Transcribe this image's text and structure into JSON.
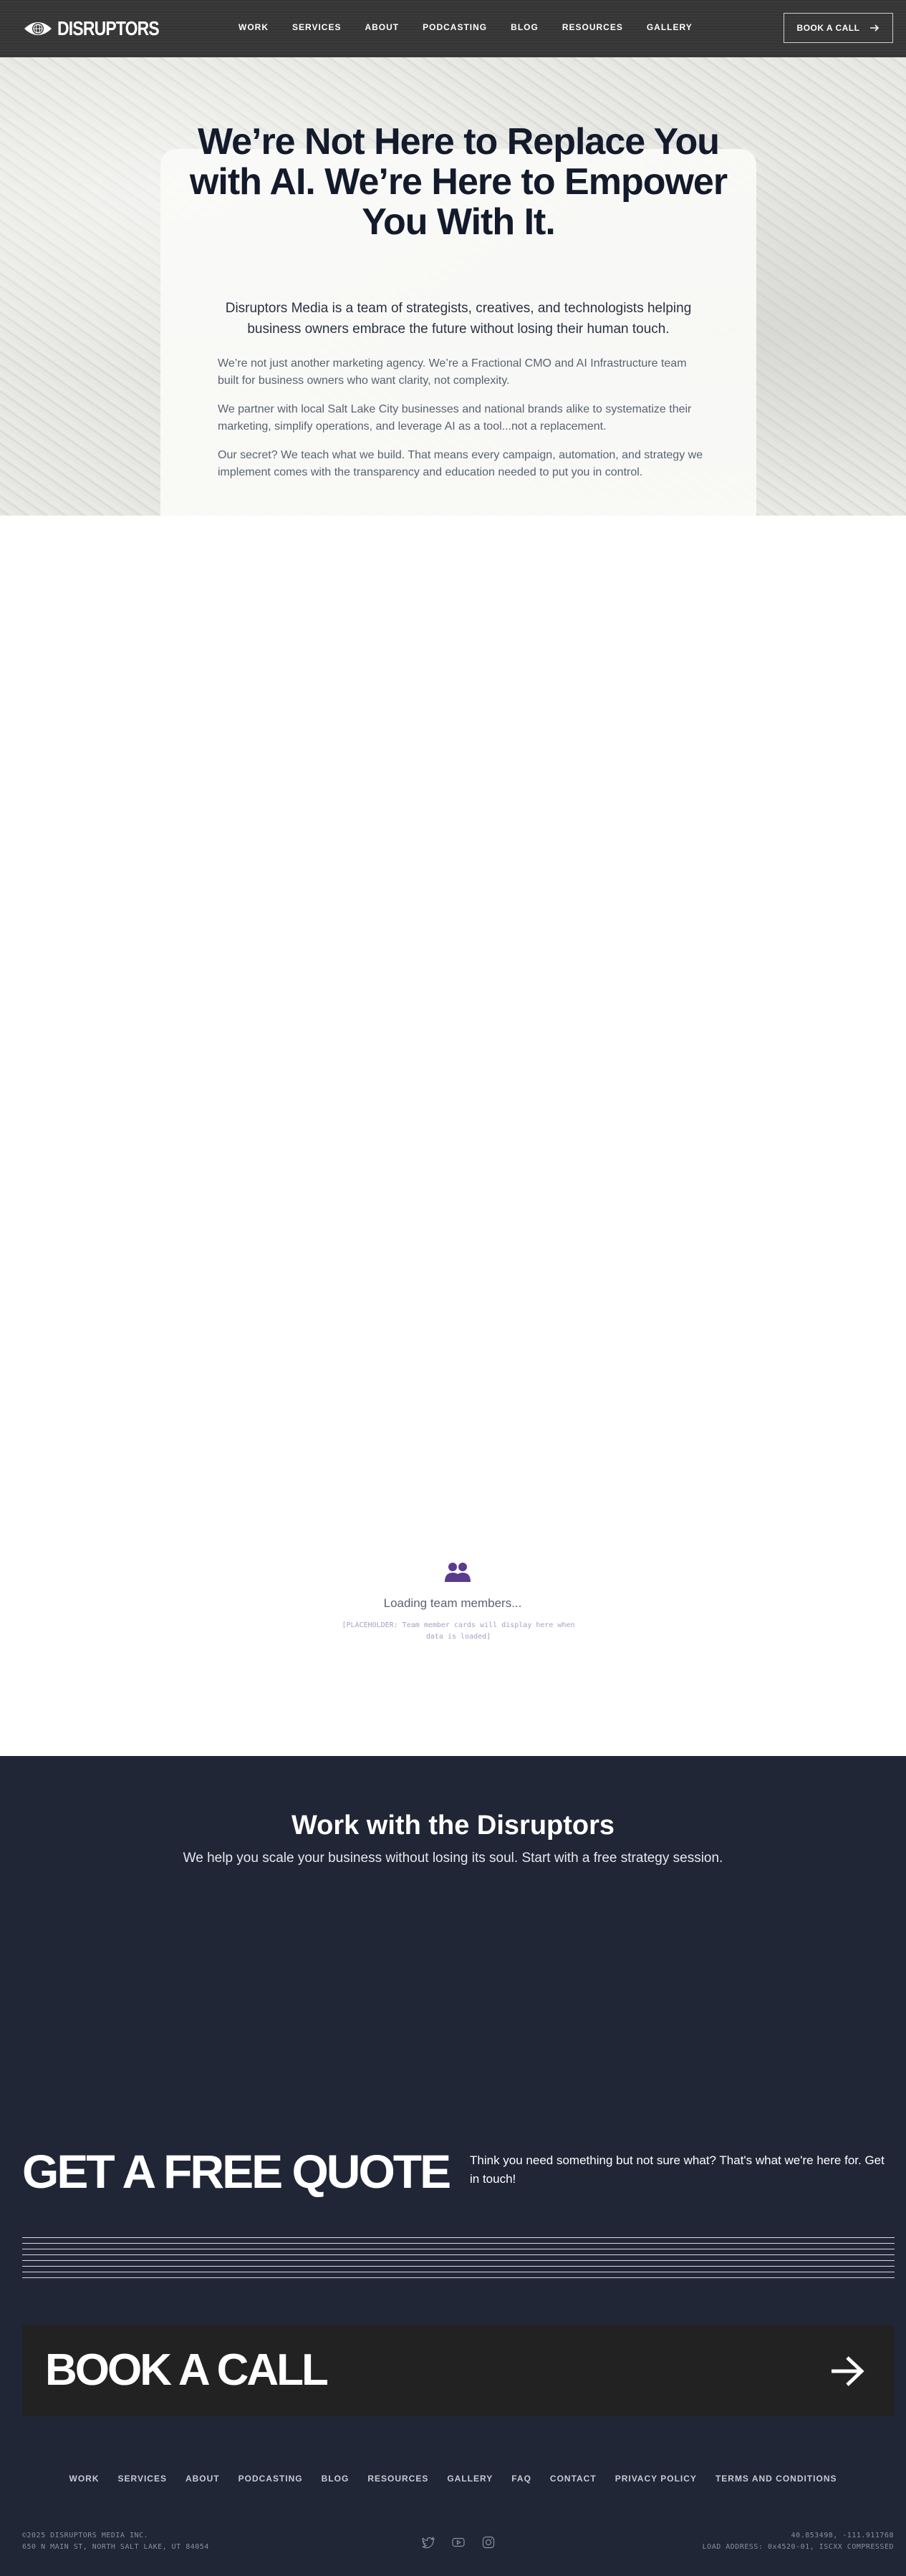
{
  "header": {
    "logo_text": "DISRUPTORS",
    "nav": [
      "WORK",
      "SERVICES",
      "ABOUT",
      "PODCASTING",
      "BLOG",
      "RESOURCES",
      "GALLERY"
    ],
    "book_label": "BOOK A CALL"
  },
  "hero": {
    "title": "We’re Not Here to Replace You with AI. We’re Here to Empower You With It.",
    "subtitle": "Disruptors Media is a team of strategists, creatives, and technologists helping business owners embrace the future without losing their human touch.",
    "p1": "We’re not just another marketing agency. We’re a Fractional CMO and AI Infrastructure team built for business owners who want clarity, not complexity.",
    "p2": "We partner with local Salt Lake City businesses and national brands alike to systematize their marketing, simplify operations, and leverage AI as a tool...not a replacement.",
    "p3": "Our secret? We teach what we build. That means every campaign, automation, and strategy we implement comes with the transparency and education needed to put you in control."
  },
  "team": {
    "loading": "Loading team members...",
    "placeholder": "[PLACEHOLDER: Team member cards will display here when data is loaded]"
  },
  "work": {
    "title": "Work with the Disruptors",
    "subtitle": "We help you scale your business without losing its soul. Start with a free strategy session."
  },
  "footer": {
    "quote_title": "GET A FREE QUOTE",
    "quote_text": "Think you need something but not sure what? That's what we're here for. Get in touch!",
    "call_text": "BOOK A CALL",
    "nav": [
      "WORK",
      "SERVICES",
      "ABOUT",
      "PODCASTING",
      "BLOG",
      "RESOURCES",
      "GALLERY",
      "FAQ",
      "CONTACT",
      "PRIVACY POLICY",
      "TERMS AND CONDITIONS"
    ],
    "copyright": "©2025 DISRUPTORS MEDIA INC.",
    "address": "650 N MAIN ST, NORTH SALT LAKE, UT 84054",
    "coordinates": "40.853498, -111.911768",
    "load_address": "LOAD ADDRESS: 0x4520-01, ISCXX COMPRESSED",
    "social_icons": [
      "twitter-icon",
      "youtube-icon",
      "instagram-icon"
    ]
  },
  "colors": {
    "header_bg": "#363636",
    "dark_bg": "#202636",
    "call_box": "#222222",
    "accent_purple": "#5b3b8c"
  }
}
